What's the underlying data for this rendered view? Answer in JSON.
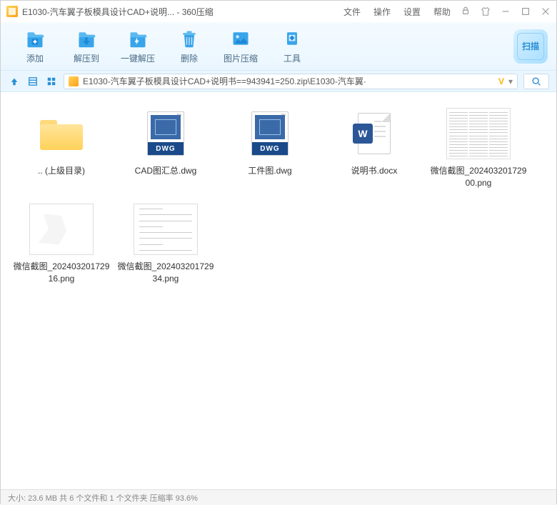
{
  "window": {
    "title": "E1030-汽车翼子板模具设计CAD+说明... - 360压缩"
  },
  "menu": {
    "file": "文件",
    "operate": "操作",
    "settings": "设置",
    "help": "帮助"
  },
  "toolbar": {
    "add": "添加",
    "extract_to": "解压到",
    "one_click": "一键解压",
    "delete": "删除",
    "image_compress": "图片压缩",
    "tools": "工具",
    "scan": "扫描"
  },
  "path": {
    "text": "E1030-汽车翼子板模具设计CAD+说明书==943941=250.zip\\E1030-汽车翼·",
    "vip_badge": "V"
  },
  "files": [
    {
      "type": "folder",
      "name": ".. (上级目录)"
    },
    {
      "type": "dwg",
      "name": "CAD图汇总.dwg"
    },
    {
      "type": "dwg",
      "name": "工件图.dwg"
    },
    {
      "type": "docx",
      "name": "说明书.docx"
    },
    {
      "type": "png1",
      "name": "微信截图_20240320172900.png"
    },
    {
      "type": "png2",
      "name": "微信截图_20240320172916.png"
    },
    {
      "type": "png3",
      "name": "微信截图_20240320172934.png"
    }
  ],
  "icon_text": {
    "dwg": "DWG",
    "tm": "™",
    "word": "W"
  },
  "status": "大小: 23.6 MB 共 6 个文件和 1 个文件夹 压缩率 93.6%"
}
